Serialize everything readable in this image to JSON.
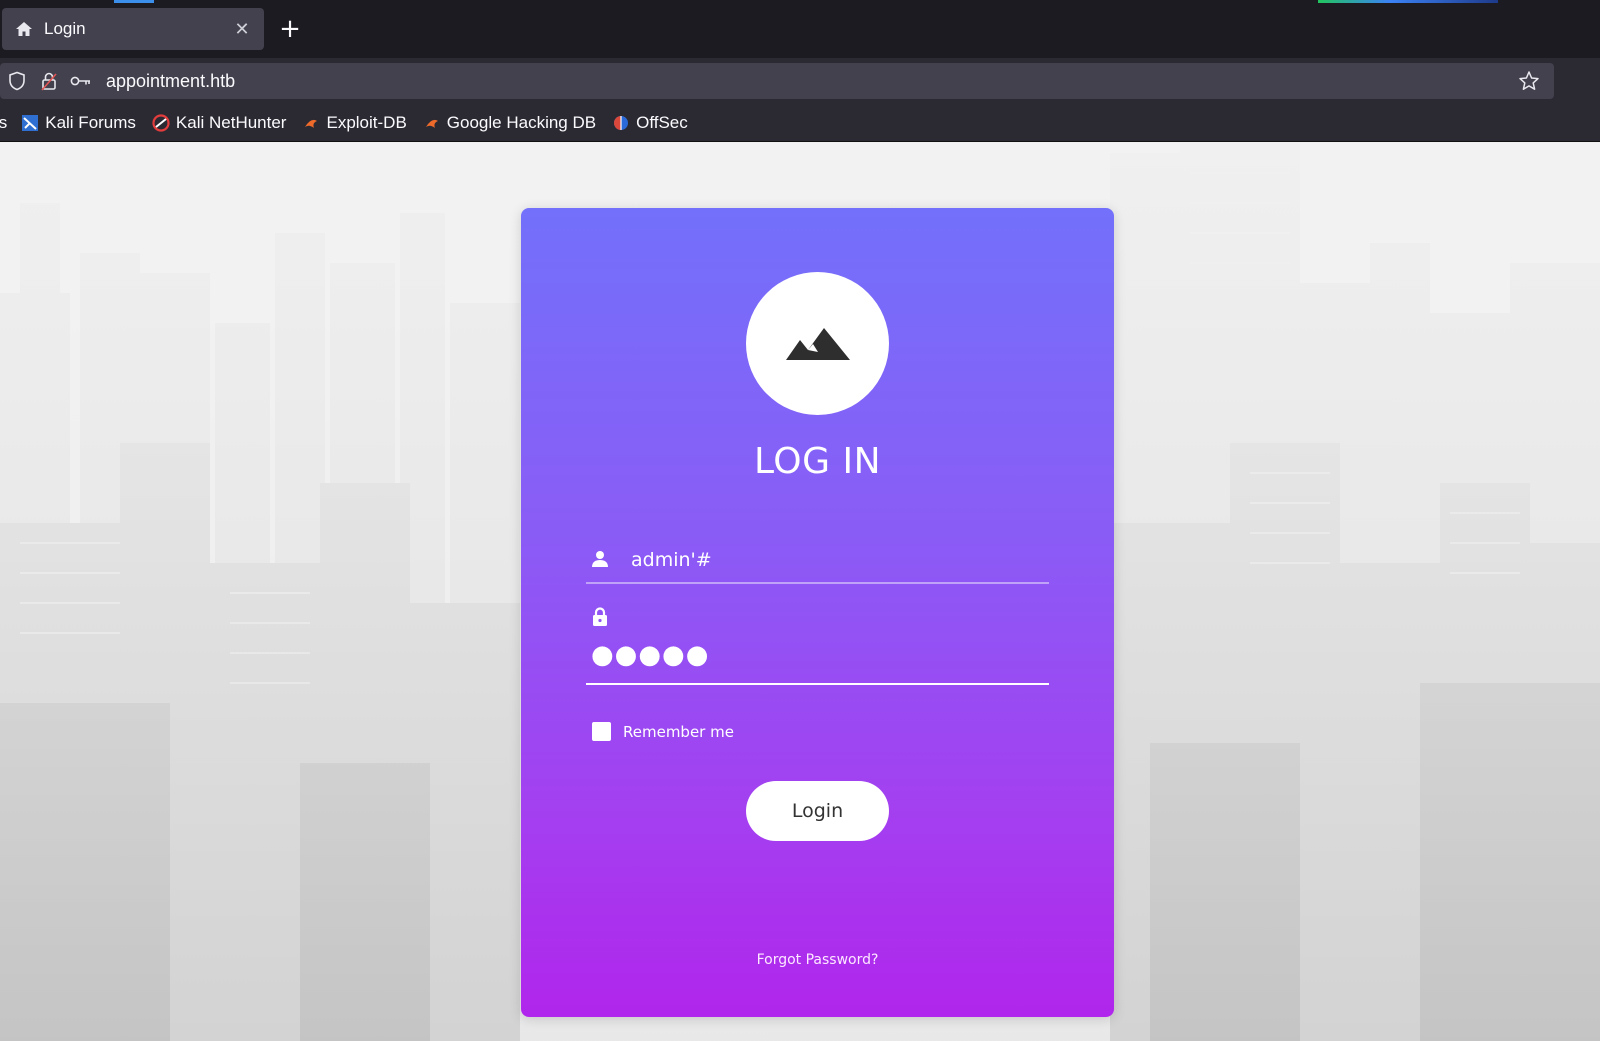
{
  "browser": {
    "tab_title": "Login",
    "url": "appointment.htb",
    "bookmarks": [
      {
        "label": "Kali Forums",
        "icon": "kali-forums-icon"
      },
      {
        "label": "Kali NetHunter",
        "icon": "kali-nethunter-icon"
      },
      {
        "label": "Exploit-DB",
        "icon": "exploit-db-icon"
      },
      {
        "label": "Google Hacking DB",
        "icon": "google-hacking-db-icon"
      },
      {
        "label": "OffSec",
        "icon": "offsec-icon"
      }
    ],
    "bookmark_cut_prefix": "ts"
  },
  "login": {
    "title": "LOG IN",
    "username_value": "admin'#",
    "password_value": "●●●●●",
    "remember_label": "Remember me",
    "login_button": "Login",
    "forgot_link": "Forgot Password?"
  },
  "colors": {
    "card_top": "#7370fb",
    "card_bottom": "#b026ec",
    "chrome_dark": "#1c1b22",
    "chrome_mid": "#2b2a33"
  }
}
